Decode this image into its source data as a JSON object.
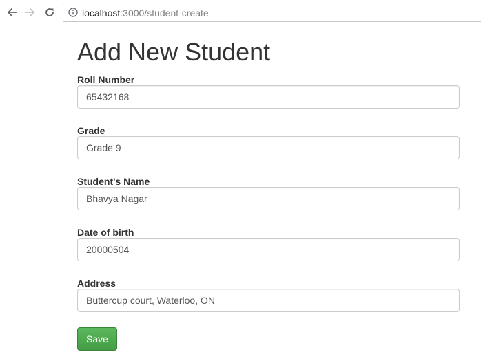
{
  "browser": {
    "url_host": "localhost",
    "url_path": ":3000/student-create"
  },
  "page": {
    "title": "Add New Student"
  },
  "form": {
    "fields": [
      {
        "label": "Roll Number",
        "value": "65432168"
      },
      {
        "label": "Grade",
        "value": "Grade 9"
      },
      {
        "label": "Student's Name",
        "value": "Bhavya Nagar"
      },
      {
        "label": "Date of birth",
        "value": "20000504"
      },
      {
        "label": "Address",
        "value": "Buttercup court, Waterloo, ON"
      }
    ],
    "save_label": "Save"
  },
  "colors": {
    "save_button": "#5cb85c",
    "text": "#333333"
  }
}
